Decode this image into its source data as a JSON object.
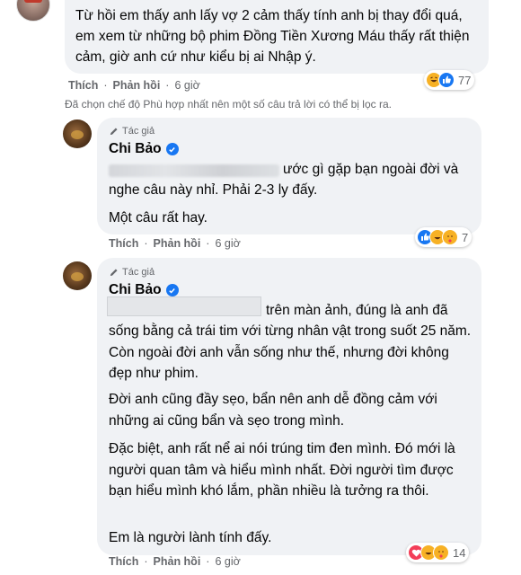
{
  "comment1": {
    "text": "Từ hồi em thấy anh lấy vợ 2 cảm thấy tính anh bị thay đổi quá, em xem từ những bộ phim Đồng Tiền Xương Máu thấy rất thiện cảm, giờ anh cứ như kiểu bị ai Nhập ý.",
    "reaction_count": "77",
    "reactions": [
      "haha-icon",
      "like-icon"
    ],
    "actions": {
      "like": "Thích",
      "reply": "Phản hồi",
      "time": "6 giờ"
    }
  },
  "filter_note": "Đã chọn chế độ Phù hợp nhất nên một số câu trả lời có thể bị lọc ra.",
  "reply1": {
    "author_tag": "Tác giả",
    "author_name": "Chi Bảo",
    "line1_visible": "ước gì gặp bạn ngoài đời và",
    "line2": "nghe câu này nhỉ. Phải 2-3 ly đấy.",
    "line3": "Một câu rất hay.",
    "reaction_count": "7",
    "reactions": [
      "like-icon",
      "haha-icon",
      "care-icon"
    ],
    "actions": {
      "like": "Thích",
      "reply": "Phản hồi",
      "time": "6 giờ"
    }
  },
  "reply2": {
    "author_tag": "Tác giả",
    "author_name": "Chi Bảo",
    "line1_visible": "trên màn ảnh, đúng là anh đã",
    "p1_rest": "sống bằng cả trái tim với từng nhân vật trong suốt 25 năm. Còn ngoài đời anh vẫn sống như thế, nhưng đời không đẹp như phim.",
    "p2": "Đời anh cũng đầy sẹo, bẩn nên anh dễ đồng cảm với những ai cũng bẩn và sẹo trong mình.",
    "p3": "Đặc biệt, anh rất nể ai nói trúng tim đen mình. Đó mới là người quan tâm và hiểu mình nhất. Đời người tìm được bạn hiểu mình khó lắm, phần nhiều là tưởng ra thôi.",
    "p4": "Em là người lành tính đấy.",
    "reaction_count": "14",
    "reactions": [
      "love-icon",
      "haha-icon",
      "care-icon"
    ],
    "actions": {
      "like": "Thích",
      "reply": "Phản hồi",
      "time": "6 giờ"
    }
  },
  "colors": {
    "bubble": "#f0f2f5",
    "meta": "#65676b",
    "text": "#050505",
    "verified": "#1877f2"
  }
}
